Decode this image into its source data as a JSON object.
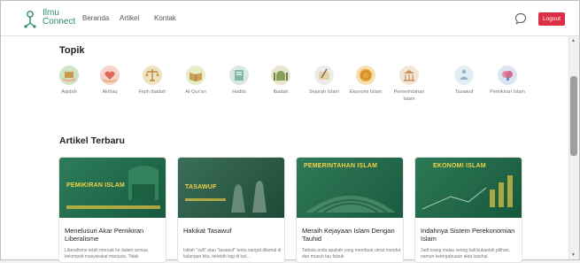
{
  "nav": {
    "brand_line1": "Ilmu",
    "brand_line2": "Connect",
    "links": [
      "Beranda",
      "Artikel",
      "Kontak"
    ],
    "logout_label": "Logout"
  },
  "topics": {
    "title": "Topik",
    "items": [
      {
        "label": "Aqidah",
        "icon": "quran-hands-icon"
      },
      {
        "label": "Akhlaq",
        "icon": "heart-hands-icon"
      },
      {
        "label": "Fiqih Ibadah",
        "icon": "scale-icon"
      },
      {
        "label": "Al-Qur'an",
        "icon": "quran-icon"
      },
      {
        "label": "Hadits",
        "icon": "book-icon"
      },
      {
        "label": "Ibadah",
        "icon": "mosque-icon"
      },
      {
        "label": "Sejarah Islam",
        "icon": "scroll-quill-icon"
      },
      {
        "label": "Ekonomi Islam",
        "icon": "coin-icon"
      },
      {
        "label": "Pemerintahan Islam",
        "icon": "government-building-icon"
      },
      {
        "label": "Tasawuf",
        "icon": "meditation-icon"
      },
      {
        "label": "Pemikiran Islam",
        "icon": "brain-icon"
      }
    ]
  },
  "articles": {
    "title": "Artikel Terbaru",
    "items": [
      {
        "tag": "PEMIKIRAN ISLAM",
        "title": "Menelusuri Akar Pemikiran Liberalisme",
        "desc": "Liberalisme telah meruak ke dalam semua kelompok masyarakat manusia. Tidak"
      },
      {
        "tag": "TASAWUF",
        "title": "Hakikat Tasawuf",
        "desc": "Istilah \"sufi\" atau \"tasawuf\" tentu sangat dikenal di kalangan kita, terlebih lagi di kal..."
      },
      {
        "tag": "PEMERINTAHAN ISLAM",
        "title": "Meraih Kejayaan Islam Dengan Tauhid",
        "desc": "Tatkala anda apakah yang membuat umat mundur dan musuh tau falsuk"
      },
      {
        "tag": "EKONOMI ISLAM",
        "title": "Indahnya Sistem Perekonomian Islam",
        "desc": "Jadi orang malas sering kali bukanlah pilihan, namun ketergabuaan akta loashai."
      }
    ]
  },
  "colors": {
    "brand": "#2e8b6e",
    "logout": "#dc2f45",
    "card_image": "#1f6e4e",
    "card_tag": "#f0d24a"
  }
}
